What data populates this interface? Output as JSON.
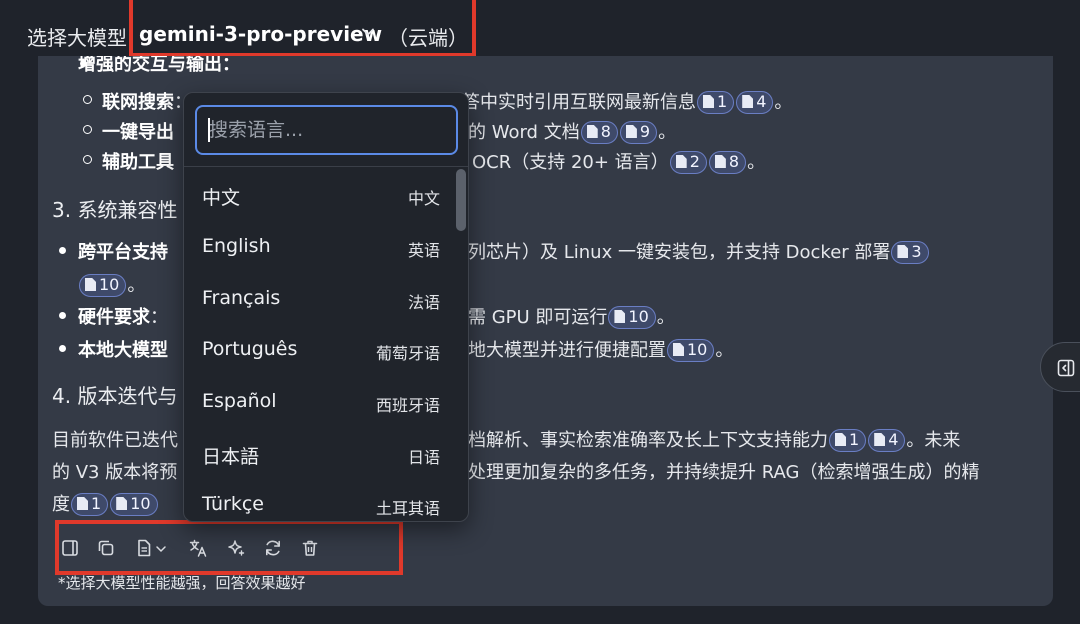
{
  "header": {
    "label": "选择大模型",
    "model": "gemini-3-pro-preview",
    "location": "（云端）"
  },
  "message": {
    "partial_heading": "增强的交互与输出：",
    "lines": {
      "web_search_label": "联网搜索",
      "web_search_text": "：整合在线搜索与引用系统，可在回答中实时引用互联网最新信息",
      "export_label": "一键导出",
      "export_text": "的 Word 文档",
      "tools_label": "辅助工具",
      "tools_text": "OCR（支持 20+ 语言）",
      "section3": "3. 系统兼容性",
      "cross_label": "跨平台支持",
      "cross_text": "系列芯片）及 Linux 一键安装包，并支持 Docker 部署",
      "hardware_label": "硬件要求",
      "hardware_text": "需 GPU 即可运行",
      "local_label": "本地大模型",
      "local_text": "地大模型并进行便捷配置",
      "section4": "4. 版本迭代与",
      "para1_a": "目前软件已迭代",
      "para1_b": "档解析、事实检索准确率及长上下文支持能力",
      "para1_c": "。未来",
      "para2_a": "的 V3 版本将预",
      "para2_b": "处理更加复杂的多任务，并持续提升 RAG（检索增强生成）的精",
      "para3_a": "度"
    },
    "refs": {
      "r1": "1",
      "r3": "3",
      "r4": "4",
      "r8": "8",
      "r9": "9",
      "r2": "2",
      "r10": "10"
    }
  },
  "dropdown": {
    "search_placeholder": "搜索语言...",
    "languages": [
      {
        "name": "中文",
        "native": "中文"
      },
      {
        "name": "English",
        "native": "英语"
      },
      {
        "name": "Français",
        "native": "法语"
      },
      {
        "name": "Português",
        "native": "葡萄牙语"
      },
      {
        "name": "Español",
        "native": "西班牙语"
      },
      {
        "name": "日本語",
        "native": "日语"
      },
      {
        "name": "Türkçe",
        "native": "土耳其语"
      }
    ]
  },
  "footnote": "*选择大模型性能越强，回答效果越好",
  "icons": {
    "toolbar": [
      "panel-icon",
      "copy-icon",
      "document-icon",
      "translate-icon",
      "sparkle-icon",
      "refresh-icon",
      "trash-icon"
    ],
    "side": "sidebar-toggle-icon"
  },
  "colors": {
    "highlight": "#e0392b",
    "accent": "#5b8ae6",
    "card": "#343a46"
  }
}
